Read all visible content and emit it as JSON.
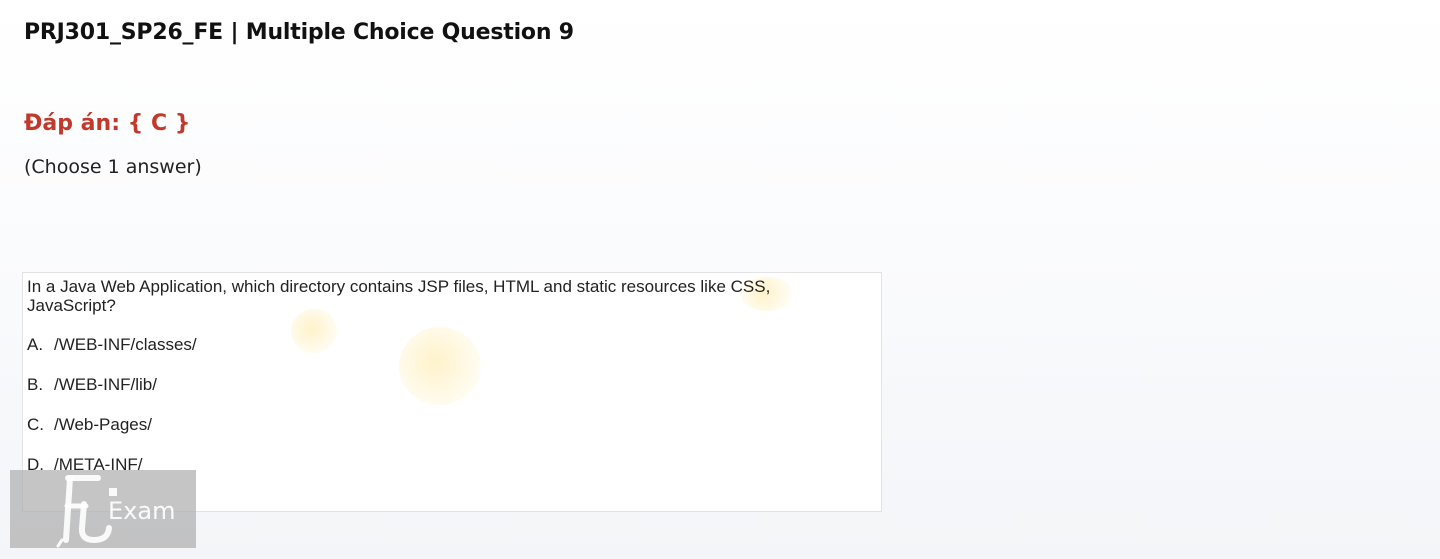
{
  "header": {
    "title": "PRJ301_SP26_FE | Multiple Choice Question 9"
  },
  "answer": {
    "label": "Đáp án: { C }"
  },
  "instruction": "(Choose 1 answer)",
  "question": {
    "text": "In a Java Web Application, which directory contains JSP files, HTML and static resources like CSS, JavaScript?",
    "options": [
      {
        "letter": "A.",
        "text": "/WEB-INF/classes/"
      },
      {
        "letter": "B.",
        "text": "/WEB-INF/lib/"
      },
      {
        "letter": "C.",
        "text": "/Web-Pages/"
      },
      {
        "letter": "D.",
        "text": "/META-INF/"
      }
    ]
  },
  "watermark": {
    "logo_icon": "fu-logo-icon",
    "text": "Exam"
  },
  "colors": {
    "answer": "#c0392b",
    "watermark_bg": "#afafaf"
  }
}
